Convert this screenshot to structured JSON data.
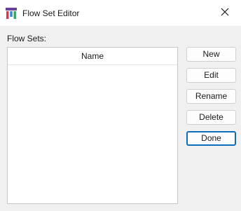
{
  "window": {
    "title": "Flow Set Editor",
    "icon": "app-icon",
    "accent": "#0f6cbd"
  },
  "flowsets": {
    "label": "Flow Sets:",
    "columns": [
      "Name"
    ],
    "rows": []
  },
  "buttons": {
    "new_label": "New",
    "edit_label": "Edit",
    "rename_label": "Rename",
    "delete_label": "Delete",
    "done_label": "Done"
  },
  "icons": {
    "close": "close-icon"
  }
}
